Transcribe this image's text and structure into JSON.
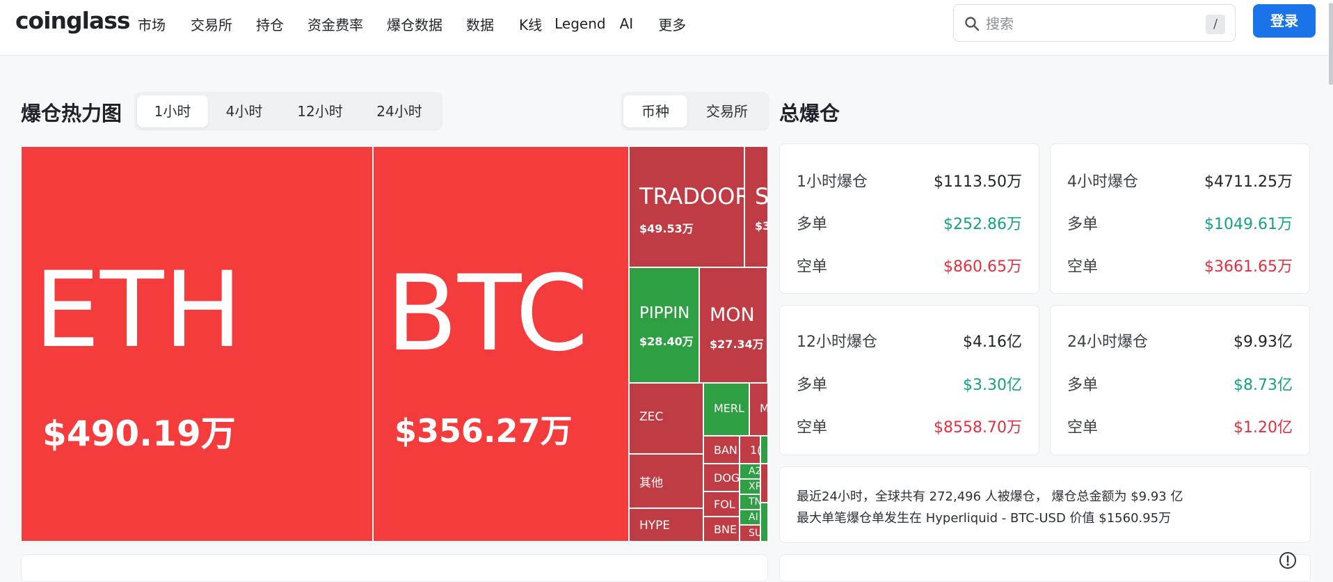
{
  "header": {
    "logo": "coinglass",
    "nav": [
      "市场",
      "交易所",
      "持仓",
      "资金费率",
      "爆仓数据",
      "数据",
      "K线",
      "Legend",
      "AI",
      "更多"
    ],
    "search_placeholder": "搜索",
    "search_shortcut": "/",
    "login_label": "登录"
  },
  "heatmap": {
    "title": "爆仓热力图",
    "time_tabs": [
      "1小时",
      "4小时",
      "12小时",
      "24小时"
    ],
    "active_time_tab": "1小时",
    "group_tabs": [
      "币种",
      "交易所"
    ],
    "active_group_tab": "币种",
    "tiles": {
      "eth": {
        "symbol": "ETH",
        "value": "$490.19万"
      },
      "btc": {
        "symbol": "BTC",
        "value": "$356.27万"
      },
      "tradoor": {
        "symbol": "TRADOOR",
        "value": "$49.53万"
      },
      "s": {
        "symbol": "S",
        "value": "$3"
      },
      "pippin": {
        "symbol": "PIPPIN",
        "value": "$28.40万"
      },
      "mon": {
        "symbol": "MON",
        "value": "$27.34万"
      },
      "zec": {
        "symbol": "ZEC"
      },
      "other": {
        "symbol": "其他"
      },
      "hype": {
        "symbol": "HYPE"
      },
      "merl": {
        "symbol": "MERL"
      },
      "m": {
        "symbol": "M"
      },
      "ban": {
        "symbol": "BAN"
      },
      "one": {
        "symbol": "1("
      },
      "doge": {
        "symbol": "DOG"
      },
      "a2": {
        "symbol": "A2"
      },
      "xp": {
        "symbol": "XP"
      },
      "fol": {
        "symbol": "FOL"
      },
      "tn": {
        "symbol": "TN"
      },
      "ai": {
        "symbol": "AI"
      },
      "bnb": {
        "symbol": "BNE"
      },
      "su": {
        "symbol": "SU"
      }
    }
  },
  "total": {
    "title": "总爆仓",
    "cards": [
      {
        "label": "1小时爆仓",
        "total": "$1113.50万",
        "long_label": "多单",
        "long": "$252.86万",
        "short_label": "空单",
        "short": "$860.65万"
      },
      {
        "label": "4小时爆仓",
        "total": "$4711.25万",
        "long_label": "多单",
        "long": "$1049.61万",
        "short_label": "空单",
        "short": "$3661.65万"
      },
      {
        "label": "12小时爆仓",
        "total": "$4.16亿",
        "long_label": "多单",
        "long": "$3.30亿",
        "short_label": "空单",
        "short": "$8558.70万"
      },
      {
        "label": "24小时爆仓",
        "total": "$9.93亿",
        "long_label": "多单",
        "long": "$8.73亿",
        "short_label": "空单",
        "short": "$1.20亿"
      }
    ],
    "summary_line1": "最近24小时，全球共有 272,496 人被爆仓， 爆仓总金额为 $9.93 亿",
    "summary_line2": "最大单笔爆仓单发生在 Hyperliquid - BTC-USD 价值 $1560.95万"
  },
  "colors": {
    "long": "#16a085",
    "short": "#e0303f",
    "accent": "#1a73e8",
    "tile_red": "#f43c3c",
    "tile_dark_red": "#bf3c44",
    "tile_green": "#2ea043"
  }
}
